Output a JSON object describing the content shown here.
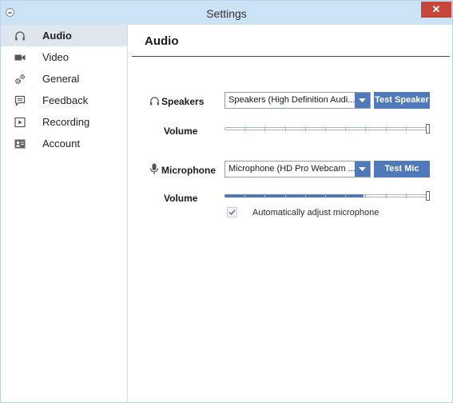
{
  "window": {
    "title": "Settings",
    "close_label": "✕"
  },
  "sidebar": {
    "items": [
      {
        "label": "Audio",
        "icon": "headphones-icon",
        "active": true
      },
      {
        "label": "Video",
        "icon": "video-camera-icon",
        "active": false
      },
      {
        "label": "General",
        "icon": "gears-icon",
        "active": false
      },
      {
        "label": "Feedback",
        "icon": "feedback-icon",
        "active": false
      },
      {
        "label": "Recording",
        "icon": "play-icon",
        "active": false
      },
      {
        "label": "Account",
        "icon": "account-icon",
        "active": false
      }
    ]
  },
  "audio": {
    "title": "Audio",
    "speakers": {
      "label": "Speakers",
      "device": "Speakers (High Definition Audi...",
      "test_button": "Test Speaker",
      "volume_label": "Volume",
      "volume_level": 1.0
    },
    "microphone": {
      "label": "Microphone",
      "device": "Microphone (HD Pro Webcam ...",
      "test_button": "Test Mic",
      "volume_label": "Volume",
      "volume_level": 1.0,
      "input_level": 0.69,
      "auto_adjust_label": "Automatically adjust microphone",
      "auto_adjust_checked": true
    }
  },
  "colors": {
    "accent": "#4f79b8",
    "titlebar": "#cce2f5",
    "close": "#c7463b",
    "active_item": "#dfe6ee"
  }
}
